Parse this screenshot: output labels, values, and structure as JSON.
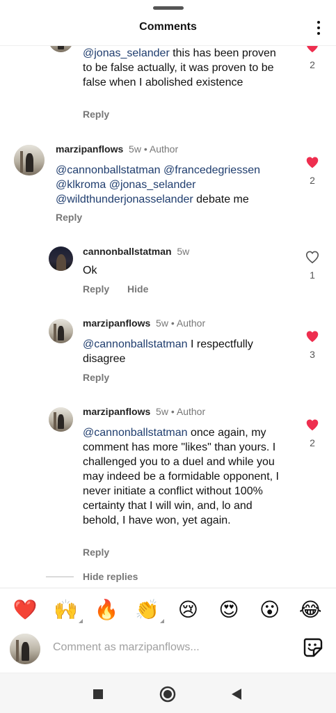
{
  "header": {
    "title": "Comments"
  },
  "comments": [
    {
      "id": "c0",
      "text": [
        {
          "type": "mention",
          "value": "@jonas_selander"
        },
        {
          "type": "text",
          "value": " this has been proven to be false actually, it was proven to be false when I abolished existence"
        }
      ],
      "reply_label": "Reply",
      "liked": true,
      "likes": "2"
    },
    {
      "id": "c1",
      "username": "marzipanflows",
      "time": "5w",
      "author": "Author",
      "text": [
        {
          "type": "mention",
          "value": "@cannonballstatman"
        },
        {
          "type": "text",
          "value": " "
        },
        {
          "type": "mention",
          "value": "@francedegriessen"
        },
        {
          "type": "text",
          "value": " "
        },
        {
          "type": "mention",
          "value": "@klkroma"
        },
        {
          "type": "text",
          "value": " "
        },
        {
          "type": "mention",
          "value": "@jonas_selander"
        },
        {
          "type": "text",
          "value": " "
        },
        {
          "type": "mention",
          "value": "@wildthunderjonasselander"
        },
        {
          "type": "text",
          "value": " debate me"
        }
      ],
      "reply_label": "Reply",
      "liked": true,
      "likes": "2"
    },
    {
      "id": "c2",
      "username": "cannonballstatman",
      "time": "5w",
      "text": [
        {
          "type": "text",
          "value": "Ok"
        }
      ],
      "reply_label": "Reply",
      "hide_label": "Hide",
      "liked": false,
      "likes": "1"
    },
    {
      "id": "c3",
      "username": "marzipanflows",
      "time": "5w",
      "author": "Author",
      "text": [
        {
          "type": "mention",
          "value": "@cannonballstatman"
        },
        {
          "type": "text",
          "value": " I respectfully disagree"
        }
      ],
      "reply_label": "Reply",
      "liked": true,
      "likes": "3"
    },
    {
      "id": "c4",
      "username": "marzipanflows",
      "time": "5w",
      "author": "Author",
      "text": [
        {
          "type": "mention",
          "value": "@cannonballstatman"
        },
        {
          "type": "text",
          "value": " once again, my comment has more \"likes\" than yours. I challenged you to a duel and while you may indeed be a formidable opponent, I never initiate a conflict without 100% certainty that I will win, and, lo and behold, I have won, yet again."
        }
      ],
      "reply_label": "Reply",
      "liked": true,
      "likes": "2"
    }
  ],
  "hide_replies_label": "Hide replies",
  "emoji_bar": [
    {
      "name": "red-heart-emoji",
      "glyph": "❤️",
      "variants": false
    },
    {
      "name": "raising-hands-emoji",
      "glyph": "🙌",
      "variants": true
    },
    {
      "name": "fire-emoji",
      "glyph": "🔥",
      "variants": false
    },
    {
      "name": "clapping-hands-emoji",
      "glyph": "👏",
      "variants": true
    },
    {
      "name": "crying-face-emoji",
      "glyph": "😢",
      "variants": false
    },
    {
      "name": "heart-eyes-emoji",
      "glyph": "😍",
      "variants": false
    },
    {
      "name": "astonished-face-emoji",
      "glyph": "😮",
      "variants": false
    },
    {
      "name": "tears-of-joy-emoji",
      "glyph": "😂",
      "variants": false
    }
  ],
  "composer": {
    "placeholder": "Comment as marzipanflows..."
  },
  "colors": {
    "like_red": "#ee2e4f",
    "mention_blue": "#1f3d6e",
    "muted": "#777777"
  },
  "icons": {
    "more": "kebab-menu-icon",
    "sticker": "sticker-icon",
    "nav_recents": "square-icon",
    "nav_home": "circle-icon",
    "nav_back": "triangle-back-icon"
  }
}
